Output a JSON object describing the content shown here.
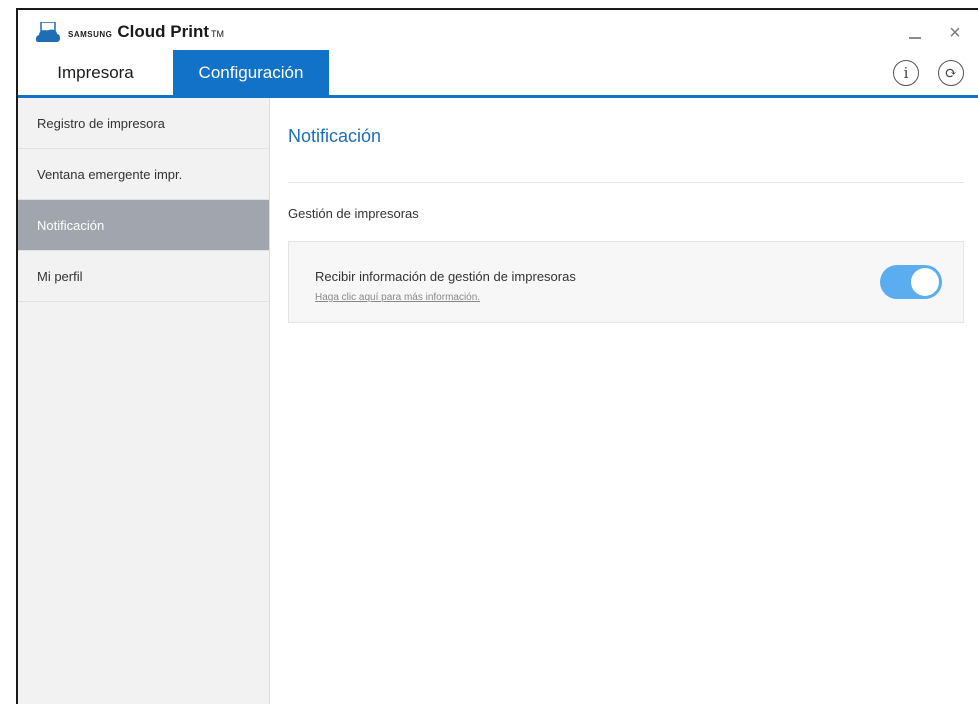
{
  "app": {
    "brand_small": "SAMSUNG",
    "brand_main": "Cloud Print",
    "brand_tm": "TM"
  },
  "window_controls": {
    "minimize": "minimize-icon",
    "close": "×"
  },
  "tabs": [
    {
      "label": "Impresora",
      "active": false
    },
    {
      "label": "Configuración",
      "active": true
    }
  ],
  "header_icons": {
    "info": "i",
    "refresh": "⟳"
  },
  "sidebar": {
    "items": [
      {
        "label": "Registro de impresora",
        "active": false
      },
      {
        "label": "Ventana emergente impr.",
        "active": false
      },
      {
        "label": "Notificación",
        "active": true
      },
      {
        "label": "Mi perfil",
        "active": false
      }
    ]
  },
  "main": {
    "title": "Notificación",
    "section_label": "Gestión de impresoras",
    "setting": {
      "label": "Recibir información de gestión de impresoras",
      "link": "Haga clic aquí para más información.",
      "enabled": true
    }
  },
  "colors": {
    "accent": "#1172c7",
    "toggle_on": "#5aaef0",
    "sidebar_active": "#a1a5ae"
  }
}
